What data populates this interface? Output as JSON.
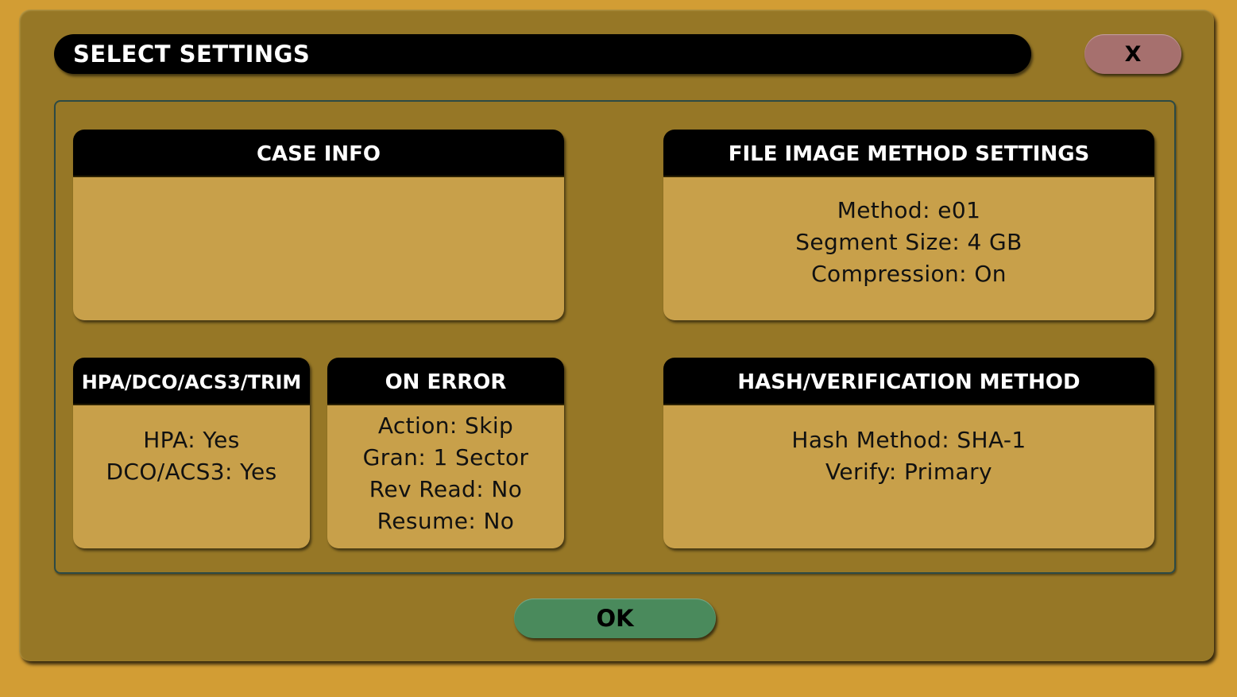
{
  "dialog": {
    "title": "SELECT SETTINGS",
    "close_label": "X",
    "ok_label": "OK"
  },
  "panels": {
    "case_info": {
      "header": "CASE INFO",
      "lines": []
    },
    "file_image": {
      "header": "FILE IMAGE METHOD SETTINGS",
      "lines": [
        "Method: e01",
        "Segment Size: 4 GB",
        "Compression: On"
      ]
    },
    "hpa": {
      "header": "HPA/DCO/ACS3/TRIM",
      "lines": [
        "HPA: Yes",
        "DCO/ACS3: Yes"
      ]
    },
    "on_error": {
      "header": "ON ERROR",
      "lines": [
        "Action: Skip",
        "Gran: 1 Sector",
        "Rev Read: No",
        "Resume: No"
      ]
    },
    "hash": {
      "header": "HASH/VERIFICATION METHOD",
      "lines": [
        "Hash Method: SHA-1",
        "Verify: Primary"
      ]
    }
  },
  "colors": {
    "background": "#d29d34",
    "dialog": "#967726",
    "panel": "#c8a04a",
    "header": "#000000",
    "close_button": "#a6706e",
    "ok_button": "#4a8a5c"
  }
}
